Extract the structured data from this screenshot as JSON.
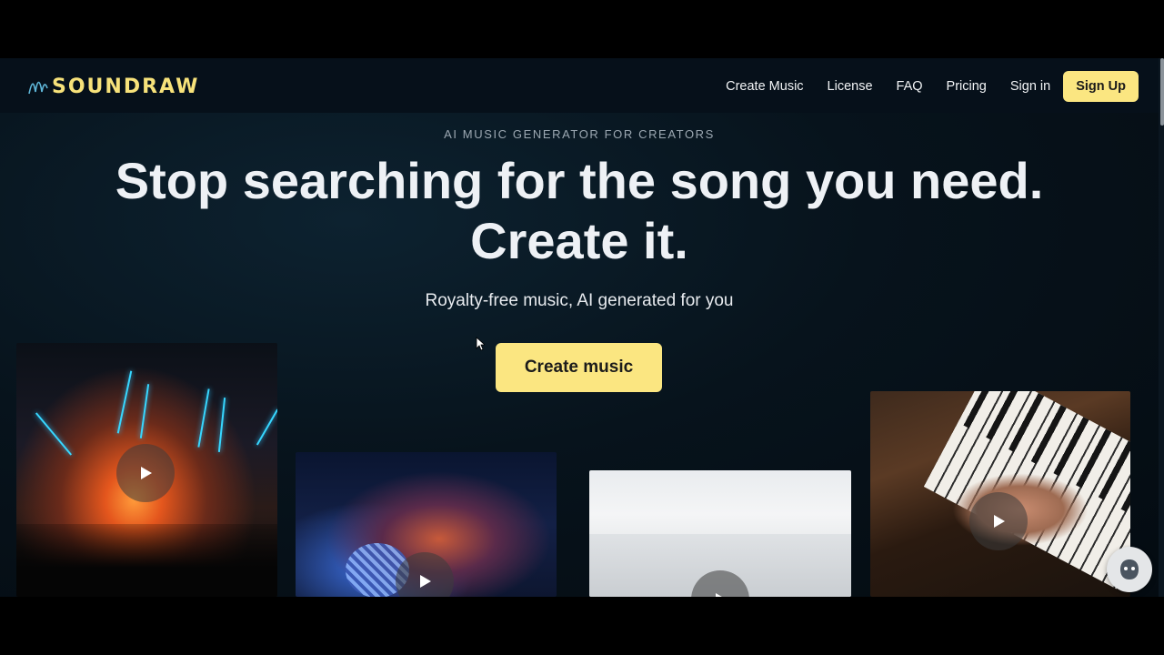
{
  "brand": {
    "name": "SOUNDRAW",
    "color": "#f7e27a"
  },
  "nav": {
    "links": [
      "Create Music",
      "License",
      "FAQ",
      "Pricing",
      "Sign in"
    ],
    "signup_label": "Sign Up"
  },
  "hero": {
    "eyebrow": "AI MUSIC GENERATOR FOR CREATORS",
    "headline_line1": "Stop searching for the song you need.",
    "headline_line2": "Create it.",
    "subhead": "Royalty-free music, AI generated for you",
    "cta_label": "Create music"
  },
  "video_cards": [
    {
      "name": "concert",
      "icon": "play-icon"
    },
    {
      "name": "disco",
      "icon": "play-icon"
    },
    {
      "name": "corridor",
      "icon": "play-icon"
    },
    {
      "name": "piano",
      "icon": "play-icon"
    }
  ],
  "colors": {
    "accent": "#fbe681",
    "background": "#06101a",
    "text": "#eef1f5"
  }
}
